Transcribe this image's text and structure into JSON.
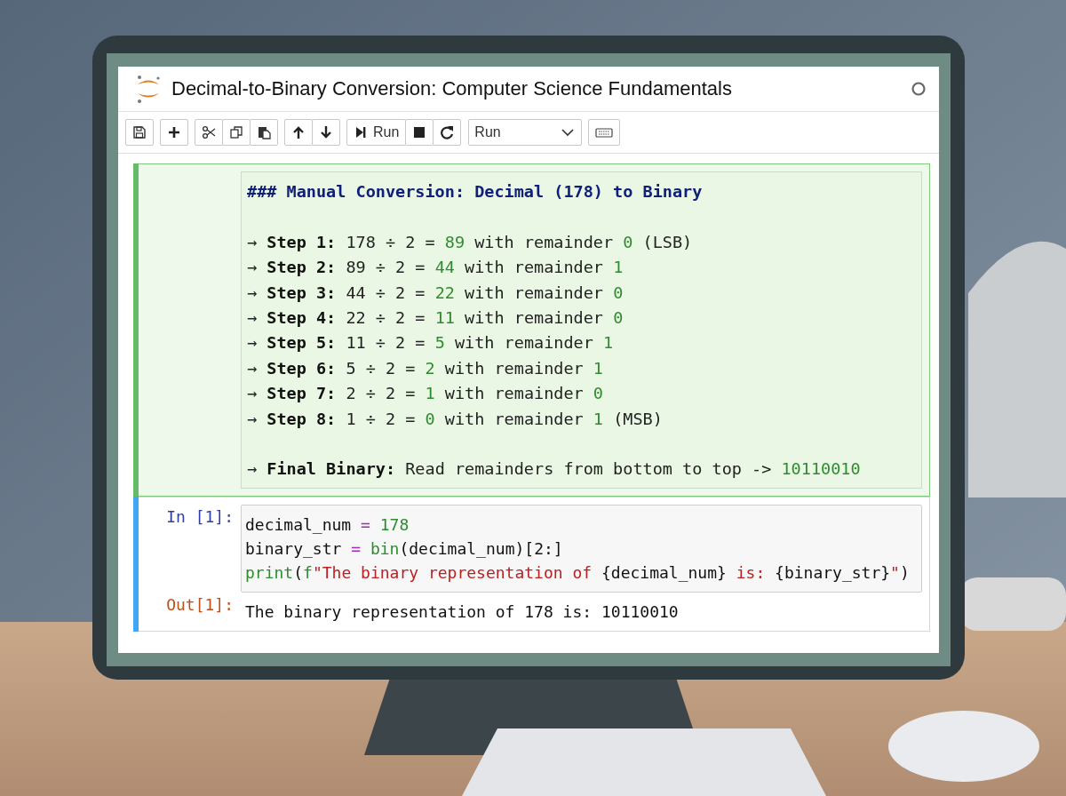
{
  "window": {
    "title": "Decimal-to-Binary Conversion: Computer Science Fundamentals"
  },
  "toolbar": {
    "groups": [
      [
        {
          "kind": "save"
        }
      ],
      [
        {
          "kind": "add"
        }
      ],
      [
        {
          "kind": "cut"
        },
        {
          "kind": "copy"
        },
        {
          "kind": "paste"
        }
      ],
      [
        {
          "kind": "up"
        },
        {
          "kind": "down"
        }
      ],
      [
        {
          "kind": "run",
          "label": "Run"
        },
        {
          "kind": "stop"
        },
        {
          "kind": "restart"
        }
      ],
      [
        {
          "kind": "dropdown",
          "value": "Run"
        }
      ],
      [
        {
          "kind": "keyboard"
        }
      ]
    ]
  },
  "cells": [
    {
      "kind": "markdown",
      "editing": true,
      "blocks": [
        [
          [
            {
              "kind": "heading",
              "text": "### Manual Conversion: Decimal (178) to Binary"
            }
          ]
        ],
        [
          [
            {
              "kind": "plain",
              "text": "→ "
            },
            {
              "kind": "bold",
              "text": "Step 1:"
            },
            {
              "kind": "plain",
              "text": " 178 ÷ 2 = "
            },
            {
              "kind": "number",
              "text": "89"
            },
            {
              "kind": "plain",
              "text": " with remainder "
            },
            {
              "kind": "number",
              "text": "0"
            },
            {
              "kind": "plain",
              "text": " (LSB)"
            }
          ],
          [
            {
              "kind": "plain",
              "text": "→ "
            },
            {
              "kind": "bold",
              "text": "Step 2:"
            },
            {
              "kind": "plain",
              "text": " 89 ÷ 2 = "
            },
            {
              "kind": "number",
              "text": "44"
            },
            {
              "kind": "plain",
              "text": " with remainder "
            },
            {
              "kind": "number",
              "text": "1"
            }
          ],
          [
            {
              "kind": "plain",
              "text": "→ "
            },
            {
              "kind": "bold",
              "text": "Step 3:"
            },
            {
              "kind": "plain",
              "text": " 44 ÷ 2 = "
            },
            {
              "kind": "number",
              "text": "22"
            },
            {
              "kind": "plain",
              "text": " with remainder "
            },
            {
              "kind": "number",
              "text": "0"
            }
          ],
          [
            {
              "kind": "plain",
              "text": "→ "
            },
            {
              "kind": "bold",
              "text": "Step 4:"
            },
            {
              "kind": "plain",
              "text": " 22 ÷ 2 = "
            },
            {
              "kind": "number",
              "text": "11"
            },
            {
              "kind": "plain",
              "text": " with remainder "
            },
            {
              "kind": "number",
              "text": "0"
            }
          ],
          [
            {
              "kind": "plain",
              "text": "→ "
            },
            {
              "kind": "bold",
              "text": "Step 5:"
            },
            {
              "kind": "plain",
              "text": " 11 ÷ 2 = "
            },
            {
              "kind": "number",
              "text": "5"
            },
            {
              "kind": "plain",
              "text": " with remainder "
            },
            {
              "kind": "number",
              "text": "1"
            }
          ],
          [
            {
              "kind": "plain",
              "text": "→ "
            },
            {
              "kind": "bold",
              "text": "Step 6:"
            },
            {
              "kind": "plain",
              "text": " 5 ÷ 2 = "
            },
            {
              "kind": "number",
              "text": "2"
            },
            {
              "kind": "plain",
              "text": " with remainder "
            },
            {
              "kind": "number",
              "text": "1"
            }
          ],
          [
            {
              "kind": "plain",
              "text": "→ "
            },
            {
              "kind": "bold",
              "text": "Step 7:"
            },
            {
              "kind": "plain",
              "text": " 2 ÷ 2 = "
            },
            {
              "kind": "number",
              "text": "1"
            },
            {
              "kind": "plain",
              "text": " with remainder "
            },
            {
              "kind": "number",
              "text": "0"
            }
          ],
          [
            {
              "kind": "plain",
              "text": "→ "
            },
            {
              "kind": "bold",
              "text": "Step 8:"
            },
            {
              "kind": "plain",
              "text": " 1 ÷ 2 = "
            },
            {
              "kind": "number",
              "text": "0"
            },
            {
              "kind": "plain",
              "text": " with remainder "
            },
            {
              "kind": "number",
              "text": "1"
            },
            {
              "kind": "plain",
              "text": " (MSB)"
            }
          ]
        ],
        [
          [
            {
              "kind": "plain",
              "text": "→ "
            },
            {
              "kind": "bold",
              "text": "Final Binary:"
            },
            {
              "kind": "plain",
              "text": " Read remainders from bottom to top -> "
            },
            {
              "kind": "number",
              "text": "10110010"
            }
          ]
        ]
      ]
    },
    {
      "kind": "code",
      "editing": false,
      "prompt": "In [1]:",
      "lines": [
        [
          {
            "kind": "plain",
            "text": "decimal_num "
          },
          {
            "kind": "op",
            "text": "= "
          },
          {
            "kind": "number",
            "text": "178"
          }
        ],
        [
          {
            "kind": "plain",
            "text": "binary_str "
          },
          {
            "kind": "op",
            "text": "= "
          },
          {
            "kind": "builtin",
            "text": "bin"
          },
          {
            "kind": "plain",
            "text": "(decimal_num)[2:]"
          }
        ],
        [
          {
            "kind": "builtin",
            "text": "print"
          },
          {
            "kind": "plain",
            "text": "("
          },
          {
            "kind": "builtin",
            "text": "f"
          },
          {
            "kind": "string",
            "text": "\"The binary representation of "
          },
          {
            "kind": "plain",
            "text": "{decimal_num}"
          },
          {
            "kind": "string",
            "text": " is: "
          },
          {
            "kind": "plain",
            "text": "{binary_str}"
          },
          {
            "kind": "string",
            "text": "\""
          },
          {
            "kind": "plain",
            "text": ")"
          }
        ]
      ],
      "output_prompt": "Out[1]:",
      "output": "The binary representation of 178 is: 10110010"
    }
  ]
}
